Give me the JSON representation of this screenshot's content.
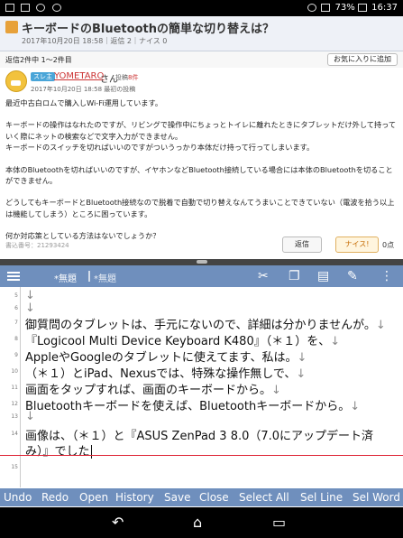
{
  "status_bar": {
    "battery": "73%",
    "time": "16:37"
  },
  "question": {
    "title": "キーボードのBluetoothの簡単な切り替えは？",
    "meta": "2017年10月20日 18:58｜返信 2｜ナイス 0",
    "reply_range": "返信2件中 1～2件目",
    "favorite_button": "お気に入りに追加",
    "badge": "スレ主",
    "username": "YOMETARO",
    "honorific": "さん",
    "post_link": "投稿",
    "post_count": "8件",
    "date": "2017年10月20日 18:58 最初の投稿",
    "body": [
      "最近中古白ロムで購入しWi-Fi運用しています。",
      "キーボードの操作はなれたのですが、リビングで操作中にちょっとトイレに離れたときにタブレットだけ外して持っていく際にネットの検索などで文字入力ができません。\nキーボードのスイッチを切ればいいのですがついうっかり本体だけ持って行ってしまいます。",
      "本体のBluetoothを切ればいいのですが、イヤホンなどBluetooth接続している場合には本体のBluetoothを切ることができません。",
      "どうしてもキーボードとBluetooth接続なので脱着で自動で切り替えなんてうまいことできていない（電波を拾う以上は機能してしまう）ところに困っています。",
      "何か対応策としている方法はないでしょうか？"
    ],
    "post_number": "書込番号：21293424",
    "reply_button": "返信",
    "nice_button": "ナイス!",
    "nice_count": "0点"
  },
  "editor_toolbar": {
    "tab1": "*無題",
    "tab2": "*無題",
    "icons": [
      "menu-icon",
      "scissors-icon",
      "copy-icon",
      "clipboard-icon",
      "edit-icon",
      "more-icon"
    ]
  },
  "editor": {
    "lines": [
      {
        "num": "5",
        "text": ""
      },
      {
        "num": "6",
        "text": ""
      },
      {
        "num": "7",
        "text": "御質問のタブレットは、手元にないので、詳細は分かりませんが。"
      },
      {
        "num": "8",
        "text": "『Logicool Multi Device Keyboard K480』（＊１）を、"
      },
      {
        "num": "9",
        "text": "AppleやGoogleのタブレットに使えてます、私は。"
      },
      {
        "num": "10",
        "text": "（＊１）とiPad、Nexusでは、特殊な操作無しで、"
      },
      {
        "num": "11",
        "text": "画面をタップすれば、画面のキーボードから。"
      },
      {
        "num": "12",
        "text": "Bluetoothキーボードを使えば、Bluetoothキーボードから。"
      },
      {
        "num": "13",
        "text": ""
      },
      {
        "num": "14",
        "text": "画像は、（＊１）と『ASUS ZenPad 3 8.0（7.0にアップデート済"
      },
      {
        "num": "",
        "text": "み）』でした"
      },
      {
        "num": "15",
        "text": ""
      }
    ],
    "return_mark": "↓"
  },
  "bottom_bar": {
    "items": [
      "Undo",
      "Redo",
      "Open",
      "History",
      "Save",
      "Close",
      "Select All",
      "Sel Line",
      "Sel Word"
    ]
  }
}
